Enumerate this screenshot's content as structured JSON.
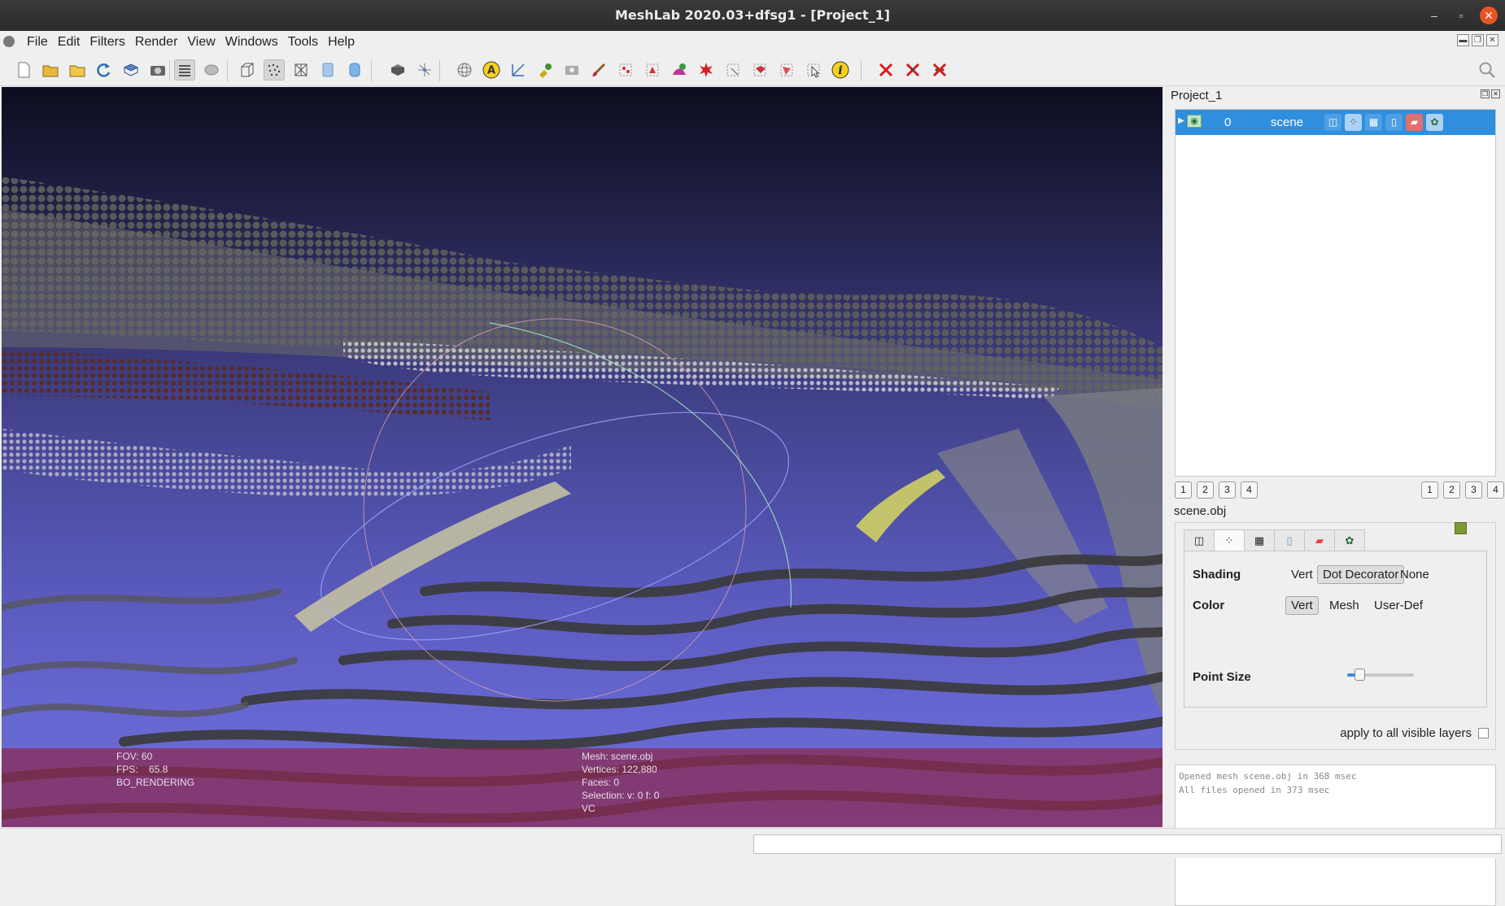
{
  "window": {
    "title": "MeshLab 2020.03+dfsg1 - [Project_1]",
    "minimize": "–",
    "restore": "▫",
    "close": "✕"
  },
  "menubar": {
    "items": [
      {
        "label": "File"
      },
      {
        "label": "Edit"
      },
      {
        "label": "Filters"
      },
      {
        "label": "Render"
      },
      {
        "label": "View"
      },
      {
        "label": "Windows"
      },
      {
        "label": "Tools"
      },
      {
        "label": "Help"
      }
    ]
  },
  "toolbar": {
    "icons": [
      "new-project-icon",
      "open-project-icon",
      "import-mesh-icon",
      "reload-icon",
      "export-mesh-icon",
      "snapshot-icon",
      "layers-icon",
      "raster-icon",
      "bounding-box-icon",
      "points-icon",
      "wireframe-icon",
      "flat-icon",
      "smooth-icon",
      "light-icon",
      "axis-icon",
      "trackball-icon",
      "annotation-icon",
      "measure-icon",
      "manipulator-icon",
      "snapshot-raster-icon",
      "paint-icon",
      "select-vertices-icon",
      "select-faces-icon",
      "z-painting-icon",
      "georef-icon",
      "select-connected-icon",
      "select-faces-rect-icon",
      "select-vertex-rect-icon",
      "pick-points-icon",
      "info-icon",
      "delete-selected-icon",
      "delete-faces-icon",
      "delete-vertices-icon",
      "search-icon"
    ]
  },
  "viewport": {
    "info_left": {
      "fov_label": "FOV:",
      "fov_value": "60",
      "fps_label": "FPS:",
      "fps_value": "65.8",
      "rendering": "BO_RENDERING"
    },
    "info_right": {
      "mesh": "Mesh: scene.obj",
      "vertices": "Vertices: 122,880",
      "faces": "Faces: 0",
      "selection": "Selection: v: 0 f: 0",
      "vc": "VC"
    }
  },
  "dock": {
    "project_title": "Project_1",
    "layer": {
      "id": "0",
      "name": "scene"
    },
    "left_numbers": [
      "1",
      "2",
      "3",
      "4"
    ],
    "right_numbers": [
      "1",
      "2",
      "3",
      "4"
    ],
    "mesh_name": "scene.obj",
    "decorator": {
      "shading_label": "Shading",
      "shading_options": [
        "Vert",
        "Dot Decorator",
        "None"
      ],
      "shading_selected": "Dot Decorator",
      "color_label": "Color",
      "color_options": [
        "Vert",
        "Mesh",
        "User-Def"
      ],
      "color_selected": "Vert",
      "user_def_color": "#7d9a38",
      "point_size_label": "Point Size",
      "point_size_fraction": 0.18,
      "apply_all_label": "apply to all visible layers",
      "apply_all_checked": false
    },
    "log": [
      "Opened mesh scene.obj in 368 msec",
      "All files opened in 373 msec"
    ]
  },
  "colors": {
    "selection_blue": "#2f8fde",
    "overlay": "#8c2850",
    "close_button": "#e95420"
  }
}
